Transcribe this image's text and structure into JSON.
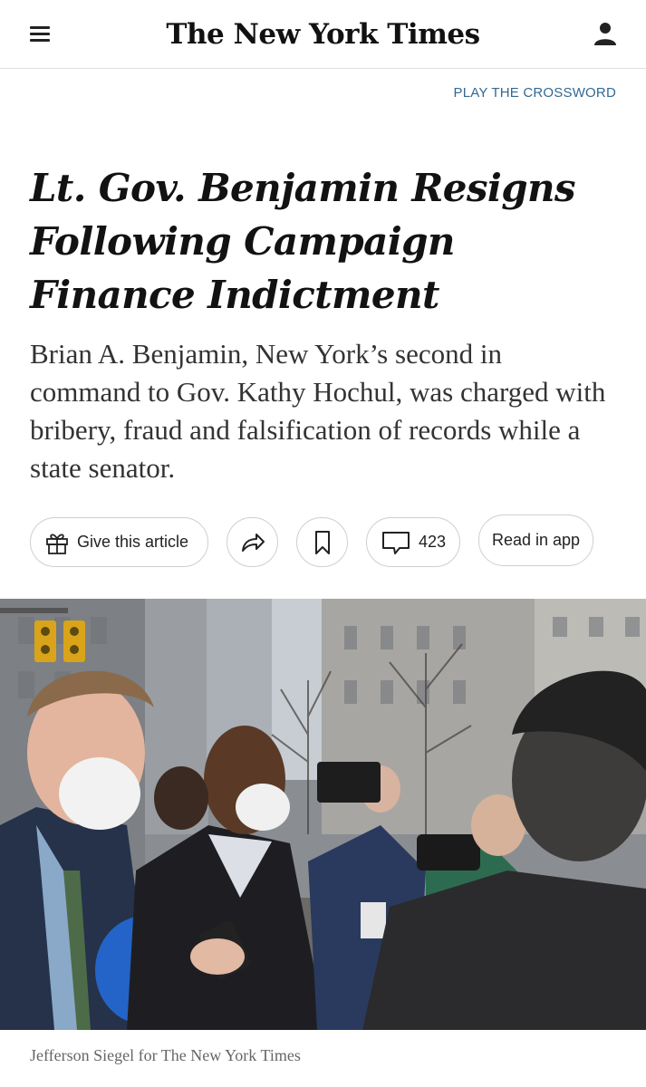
{
  "header": {
    "logo_text": "The New York Times",
    "menu_icon": "hamburger-menu-icon",
    "account_icon": "user-account-icon"
  },
  "crossword_link": "PLAY THE CROSSWORD",
  "article": {
    "headline": "Lt. Gov. Benjamin Resigns Following Campaign Finance Indictment",
    "summary": "Brian A. Benjamin, New York’s second in command to Gov. Kathy Hochul, was charged with bribery, fraud and falsification of records while a state senator.",
    "photo_credit": "Jefferson Siegel for The New York Times"
  },
  "actions": {
    "gift_label": "Give this article",
    "gift_icon": "gift-icon",
    "share_icon": "share-arrow-icon",
    "save_icon": "bookmark-icon",
    "comment_icon": "comment-bubble-icon",
    "comment_count": "423",
    "read_in_app_label": "Read in app"
  },
  "colors": {
    "link": "#326891",
    "text": "#121212",
    "border": "#dfdfdf"
  }
}
